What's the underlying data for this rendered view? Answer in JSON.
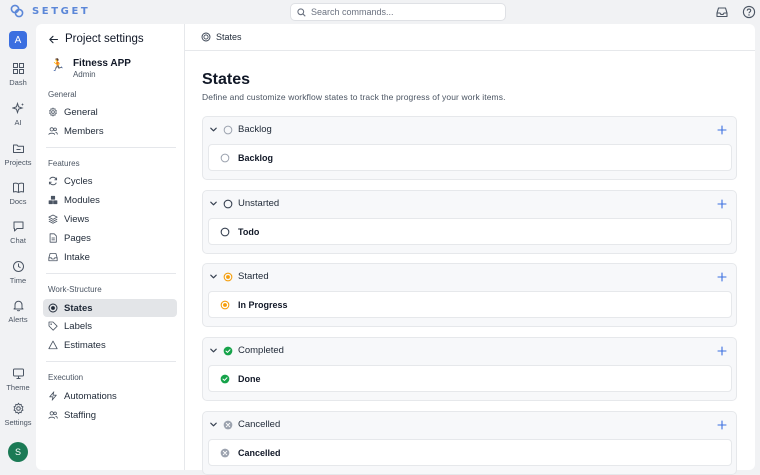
{
  "brand": {
    "name": "SETGET"
  },
  "search": {
    "placeholder": "Search commands..."
  },
  "rail": {
    "avatar_top": "A",
    "items": [
      {
        "label": "Dash",
        "icon": "dashboard-icon"
      },
      {
        "label": "AI",
        "icon": "sparkle-icon"
      },
      {
        "label": "Projects",
        "icon": "folder-icon"
      },
      {
        "label": "Docs",
        "icon": "book-icon"
      },
      {
        "label": "Chat",
        "icon": "chat-icon"
      },
      {
        "label": "Time",
        "icon": "clock-icon"
      },
      {
        "label": "Alerts",
        "icon": "bell-icon"
      },
      {
        "label": "Theme",
        "icon": "monitor-icon"
      },
      {
        "label": "Settings",
        "icon": "gear-icon"
      }
    ],
    "avatar_bottom": "S"
  },
  "panel": {
    "title": "Project settings",
    "project": {
      "emoji": "🏃",
      "name": "Fitness APP",
      "role": "Admin"
    },
    "sections": [
      {
        "label": "General",
        "items": [
          "General",
          "Members"
        ]
      },
      {
        "label": "Features",
        "items": [
          "Cycles",
          "Modules",
          "Views",
          "Pages",
          "Intake"
        ]
      },
      {
        "label": "Work-Structure",
        "items": [
          "States",
          "Labels",
          "Estimates"
        ]
      },
      {
        "label": "Execution",
        "items": [
          "Automations",
          "Staffing"
        ]
      }
    ],
    "active_item": "States"
  },
  "breadcrumb": {
    "label": "States"
  },
  "page": {
    "title": "States",
    "description": "Define and customize workflow states to track the progress of your work items."
  },
  "groups": [
    {
      "name": "Backlog",
      "state": "Backlog",
      "kind": "backlog",
      "color": "#9ca3af"
    },
    {
      "name": "Unstarted",
      "state": "Todo",
      "kind": "unstarted",
      "color": "#374151"
    },
    {
      "name": "Started",
      "state": "In Progress",
      "kind": "started",
      "color": "#f59e0b"
    },
    {
      "name": "Completed",
      "state": "Done",
      "kind": "completed",
      "color": "#16a34a"
    },
    {
      "name": "Cancelled",
      "state": "Cancelled",
      "kind": "cancelled",
      "color": "#9ca3af"
    }
  ],
  "colors": {
    "accent": "#3b6fe0",
    "brand_text": "#5b87d8",
    "avatar_bottom": "#1b7a55"
  }
}
